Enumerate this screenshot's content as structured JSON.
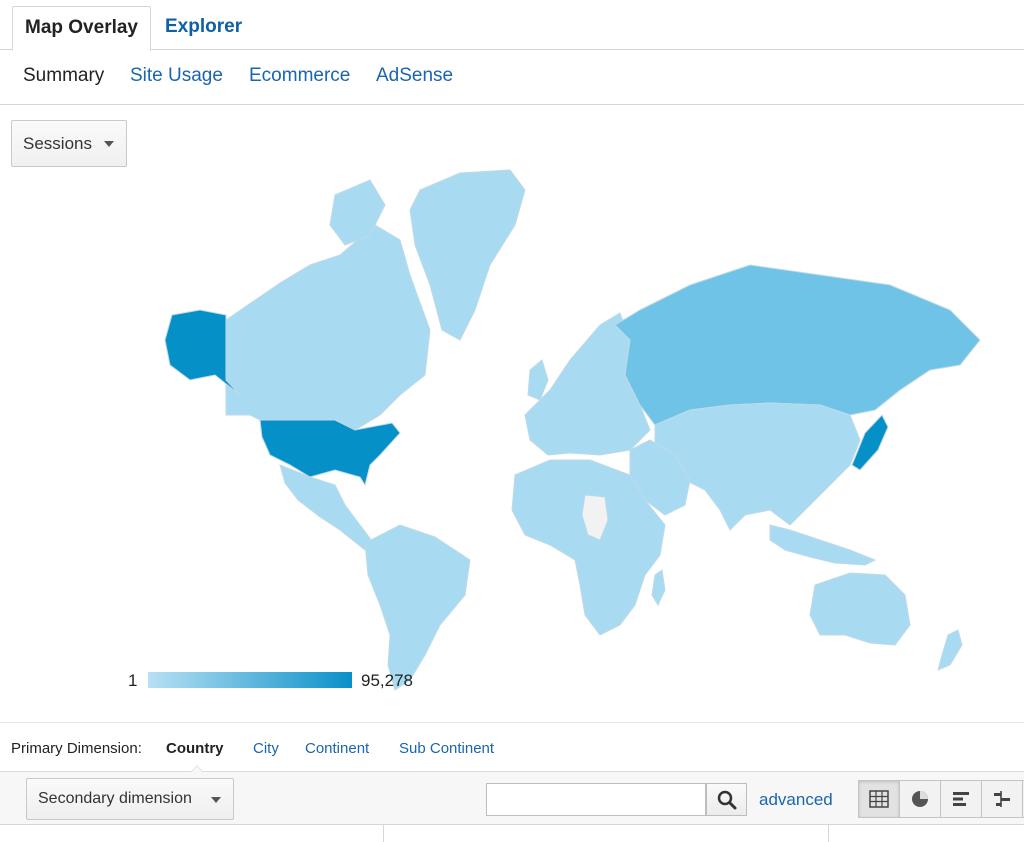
{
  "tabs": [
    {
      "label": "Map Overlay",
      "active": true
    },
    {
      "label": "Explorer",
      "active": false
    }
  ],
  "subtabs": [
    {
      "label": "Summary",
      "active": true
    },
    {
      "label": "Site Usage",
      "active": false
    },
    {
      "label": "Ecommerce",
      "active": false
    },
    {
      "label": "AdSense",
      "active": false
    }
  ],
  "metric_select": {
    "value": "Sessions"
  },
  "legend": {
    "min": "1",
    "max": "95,278",
    "color_low": "#b8e0f4",
    "color_high": "#0a90c8"
  },
  "map": {
    "colors": {
      "high": "#0590c8",
      "mid": "#6ec3e6",
      "low": "#a8dbf2",
      "none": "#f2f2f2"
    },
    "regions": [
      {
        "name": "United States",
        "level": "high"
      },
      {
        "name": "Alaska",
        "level": "high"
      },
      {
        "name": "Japan",
        "level": "high"
      },
      {
        "name": "Russia",
        "level": "mid"
      },
      {
        "name": "Canada",
        "level": "low"
      },
      {
        "name": "Greenland",
        "level": "low"
      }
    ]
  },
  "primary_dimension": {
    "label": "Primary Dimension:",
    "options": [
      {
        "label": "Country",
        "active": true
      },
      {
        "label": "City",
        "active": false
      },
      {
        "label": "Continent",
        "active": false
      },
      {
        "label": "Sub Continent",
        "active": false
      }
    ]
  },
  "toolbar": {
    "secondary_dimension": "Secondary dimension",
    "search_value": "",
    "search_placeholder": "",
    "advanced_label": "advanced",
    "view_buttons": [
      {
        "icon": "grid-icon",
        "active": true
      },
      {
        "icon": "pie-chart-icon",
        "active": false
      },
      {
        "icon": "bar-performance-icon",
        "active": false
      },
      {
        "icon": "comparison-icon",
        "active": false
      }
    ]
  }
}
